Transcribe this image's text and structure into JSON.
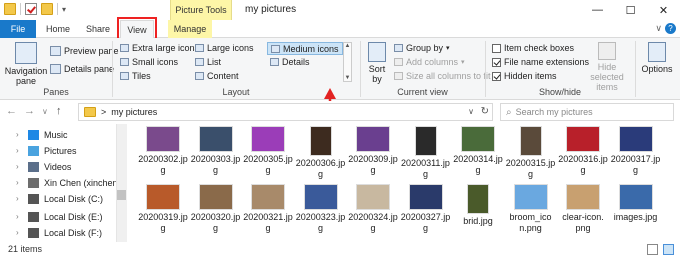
{
  "window": {
    "title": "my pictures",
    "context_tab_group": "Picture Tools",
    "controls": {
      "minimize": "—",
      "maximize": "☐",
      "close": "✕"
    }
  },
  "ribbon_tabs": {
    "file": "File",
    "home": "Home",
    "share": "Share",
    "view": "View",
    "manage": "Manage",
    "active": "View"
  },
  "ribbon": {
    "panes": {
      "label": "Panes",
      "navigation_pane": "Navigation pane",
      "preview_pane": "Preview pane",
      "details_pane": "Details pane"
    },
    "layout": {
      "label": "Layout",
      "extra_large_icons": "Extra large icons",
      "large_icons": "Large icons",
      "medium_icons": "Medium icons",
      "small_icons": "Small icons",
      "list": "List",
      "details": "Details",
      "tiles": "Tiles",
      "content": "Content",
      "selected": "Medium icons"
    },
    "current_view": {
      "label": "Current view",
      "sort_by": "Sort by",
      "group_by": "Group by",
      "add_columns": "Add columns",
      "size_all_columns": "Size all columns to fit"
    },
    "show_hide": {
      "label": "Show/hide",
      "item_check_boxes": "Item check boxes",
      "item_check_boxes_checked": false,
      "file_name_extensions": "File name extensions",
      "file_name_extensions_checked": true,
      "hidden_items": "Hidden items",
      "hidden_items_checked": true,
      "hide_selected_items": "Hide selected items"
    },
    "options": {
      "label": "Options"
    }
  },
  "address_bar": {
    "path_separator": ">",
    "path": "my pictures",
    "search_placeholder": "Search my pictures"
  },
  "nav_pane": {
    "items": [
      {
        "label": "Music",
        "icon": "music-icon",
        "color": "#1e88e5"
      },
      {
        "label": "Pictures",
        "icon": "pictures-icon",
        "color": "#4aa3df"
      },
      {
        "label": "Videos",
        "icon": "videos-icon",
        "color": "#5b6f8a"
      },
      {
        "label": "Xin Chen (xinchen-p",
        "icon": "user-drive-icon",
        "color": "#6d6d6d"
      },
      {
        "label": "Local Disk (C:)",
        "icon": "drive-icon",
        "color": "#555555"
      },
      {
        "label": "Local Disk (E:)",
        "icon": "drive-icon",
        "color": "#555555"
      },
      {
        "label": "Local Disk (F:)",
        "icon": "drive-icon",
        "color": "#555555"
      }
    ]
  },
  "files": {
    "row1": [
      {
        "name": "20200302.jp",
        "name2": "g",
        "color": "#7a4a8c"
      },
      {
        "name": "20200303.jp",
        "name2": "g",
        "color": "#3a4f6b"
      },
      {
        "name": "20200305.jp",
        "name2": "g",
        "color": "#9b3db8"
      },
      {
        "name": "20200306.jp",
        "name2": "g",
        "color": "#3d2b1f",
        "portrait": true
      },
      {
        "name": "20200309.jp",
        "name2": "g",
        "color": "#6a3f8f"
      },
      {
        "name": "20200311.jp",
        "name2": "g",
        "color": "#2a2a2a",
        "portrait": true
      },
      {
        "name": "20200314.jp",
        "name2": "g",
        "color": "#4a6b3a"
      },
      {
        "name": "20200315.jp",
        "name2": "g",
        "color": "#5a4a3a",
        "portrait": true
      },
      {
        "name": "20200316.jp",
        "name2": "g",
        "color": "#b8202a"
      },
      {
        "name": "20200317.jp",
        "name2": "g",
        "color": "#2a3b7a"
      }
    ],
    "row2": [
      {
        "name": "20200319.jp",
        "name2": "g",
        "color": "#b85a2a"
      },
      {
        "name": "20200320.jp",
        "name2": "g",
        "color": "#8a6a4a"
      },
      {
        "name": "20200321.jp",
        "name2": "g",
        "color": "#a88a6a"
      },
      {
        "name": "20200323.jp",
        "name2": "g",
        "color": "#3a5a9a"
      },
      {
        "name": "20200324.jp",
        "name2": "g",
        "color": "#c8b8a0"
      },
      {
        "name": "20200327.jp",
        "name2": "g",
        "color": "#2a3a6a"
      },
      {
        "name": "brid.jpg",
        "name2": "",
        "color": "#4a5a2a",
        "portrait": true
      },
      {
        "name": "broom_ico",
        "name2": "n.png",
        "color": "#6aa8e0"
      },
      {
        "name": "clear-icon.",
        "name2": "png",
        "color": "#c8a070"
      },
      {
        "name": "images.jpg",
        "name2": "",
        "color": "#3a6aaa"
      }
    ]
  },
  "status": {
    "item_count": "21 items"
  },
  "colors": {
    "accent": "#1979ca",
    "highlight": "#cce4f7",
    "annotation_red": "#e22222",
    "context_tab": "#fdf6a7"
  }
}
